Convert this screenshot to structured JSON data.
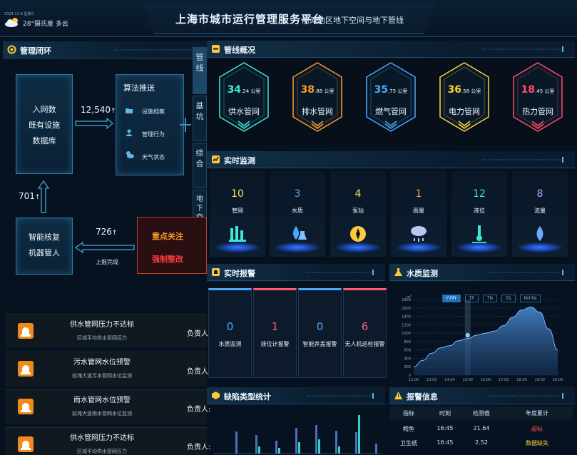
{
  "header": {
    "title": "上海市城市运行管理服务平台",
    "subtitle": "· 前滩地区地下空间与地下管线",
    "date": "2024-11-6  星期三",
    "weather": "28°摄氏度 多云"
  },
  "loop": {
    "panel_title": "管理闭环",
    "source_box": [
      "入网数",
      "既有设施",
      "数据库"
    ],
    "count_in": "12,540",
    "count_in_arrow": "↑",
    "algo_title": "算法推送",
    "algo_items": [
      "设施档案",
      "管理行为",
      "天气状态"
    ],
    "focus_box": [
      "重点关注",
      "强制整改"
    ],
    "count_report": "726",
    "count_report_arrow": "↑",
    "report_label": "上报完成",
    "ai_box": [
      "智能核复",
      "机器管人"
    ],
    "count_ai": "701",
    "count_ai_arrow": "↑"
  },
  "side_tabs": [
    "管线",
    "基坑",
    "综合",
    "地下空间"
  ],
  "alerts": [
    {
      "title": "供水管网压力不达标",
      "desc": "区域平均供水管网压力",
      "person": "负责人:"
    },
    {
      "title": "污水管网水位预警",
      "desc": "前滩大道污水管网水位监测",
      "person": "负责人:"
    },
    {
      "title": "雨水管网水位预警",
      "desc": "前滩大道雨水管网水位监测",
      "person": "负责人:"
    },
    {
      "title": "供水管网压力不达标",
      "desc": "区域平均供水管网压力",
      "person": "负责人:"
    }
  ],
  "overview": {
    "panel_title": "管线概况",
    "items": [
      {
        "int": "34",
        "dec": ".24",
        "unit": "公里",
        "name": "供水管网",
        "color": "#3fe6d8"
      },
      {
        "int": "38",
        "dec": ".88",
        "unit": "公里",
        "name": "排水管网",
        "color": "#ff9a2a"
      },
      {
        "int": "35",
        "dec": ".75",
        "unit": "公里",
        "name": "燃气管网",
        "color": "#4aa8ff"
      },
      {
        "int": "36",
        "dec": ".58",
        "unit": "公里",
        "name": "电力管网",
        "color": "#ffd33a"
      },
      {
        "int": "18",
        "dec": ".45",
        "unit": "公里",
        "name": "热力管网",
        "color": "#ff4d6a"
      }
    ]
  },
  "monitor": {
    "panel_title": "实时监测",
    "items": [
      {
        "value": "10",
        "name": "管网",
        "color": "#ffe36a",
        "icon": "pipe-icon"
      },
      {
        "value": "3",
        "name": "水质",
        "color": "#4aa8ff",
        "icon": "water-quality-icon"
      },
      {
        "value": "4",
        "name": "泵站",
        "color": "#ffe36a",
        "icon": "pump-icon"
      },
      {
        "value": "1",
        "name": "雨量",
        "color": "#ffa24a",
        "icon": "rain-icon"
      },
      {
        "value": "12",
        "name": "液位",
        "color": "#3fe6d8",
        "icon": "level-icon"
      },
      {
        "value": "8",
        "name": "流量",
        "color": "#b99bff",
        "icon": "flow-icon"
      }
    ]
  },
  "realtime_alarm": {
    "panel_title": "实时报警",
    "items": [
      {
        "value": "0",
        "name": "水质监测",
        "color": "#4aa8ff"
      },
      {
        "value": "1",
        "name": "液位计报警",
        "color": "#ff5a7a"
      },
      {
        "value": "0",
        "name": "智能井盖报警",
        "color": "#4aa8ff"
      },
      {
        "value": "6",
        "name": "无人机巡检报警",
        "color": "#ff5a7a"
      }
    ]
  },
  "water_quality": {
    "panel_title": "水质监测",
    "tabs": [
      "COD",
      "TP",
      "TN",
      "SS",
      "NH3N"
    ],
    "active_tab": "COD"
  },
  "chart_data": {
    "type": "area",
    "ylabel": "m³",
    "x": [
      "12:00",
      "13:00",
      "14:00",
      "15:00",
      "16:00",
      "17:00",
      "18:00",
      "19:00",
      "20:00"
    ],
    "xvals": [
      0,
      0.5,
      1,
      1.5,
      2,
      2.5,
      3,
      3.5,
      4,
      4.5,
      5,
      5.5,
      6,
      6.5,
      7,
      7.5,
      8
    ],
    "values": [
      200,
      350,
      520,
      650,
      700,
      820,
      870,
      950,
      1000,
      1050,
      1180,
      1380,
      1550,
      1620,
      1500,
      1100,
      600
    ],
    "ylim": [
      0,
      1800
    ],
    "yticks": [
      0,
      200,
      400,
      600,
      800,
      1000,
      1200,
      1400,
      1600,
      1800
    ],
    "highlight_x": 3,
    "highlight_value": 950
  },
  "defect": {
    "panel_title": "缺陷类型统计",
    "bars": [
      {
        "label": "",
        "value": 0
      }
    ]
  },
  "alarm_info": {
    "panel_title": "报警信息",
    "headers": [
      "指标",
      "时刻",
      "检测值",
      "年度累计"
    ],
    "rows": [
      {
        "name": "鳕鱼",
        "time": "16:45",
        "value": "21.64",
        "status": "超标",
        "status_color": "#ff4d4d"
      },
      {
        "name": "卫生纸",
        "time": "16:45",
        "value": "2.52",
        "status": "数据缺失",
        "status_color": "#ffd33a"
      }
    ]
  }
}
